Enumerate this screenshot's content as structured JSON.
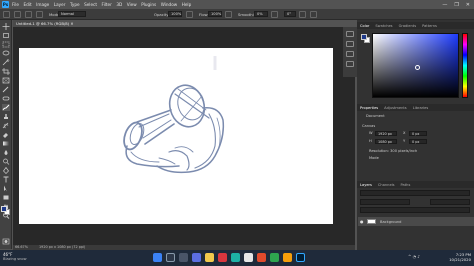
{
  "menu": {
    "items": [
      "File",
      "Edit",
      "Image",
      "Layer",
      "Type",
      "Select",
      "Filter",
      "3D",
      "View",
      "Plugins",
      "Window",
      "Help"
    ],
    "window_controls": [
      "—",
      "❐",
      "✕"
    ]
  },
  "options_bar": {
    "mode_label": "Mode:",
    "mode_value": "Normal",
    "opacity_label": "Opacity:",
    "opacity_value": "100%",
    "flow_label": "Flow:",
    "flow_value": "100%",
    "smoothing_label": "Smoothing:",
    "smoothing_value": "0%",
    "angle_value": "0°"
  },
  "document": {
    "tab_title": "Untitled-1 @ 66.7% (RGB/8) ✕"
  },
  "status_bar": {
    "zoom": "66.67%",
    "doc_size": "1920 px x 1080 px (72 ppi)"
  },
  "color_panel": {
    "tabs": [
      "Color",
      "Swatches",
      "Gradients",
      "Patterns"
    ],
    "active_tab": "Color",
    "foreground": "#1f3a8a",
    "background": "#ffffff"
  },
  "properties_panel": {
    "tabs": [
      "Properties",
      "Adjustments",
      "Libraries"
    ],
    "section": "Document",
    "canvas_heading": "Canvas",
    "width_value": "1920 px",
    "height_value": "1080 px",
    "x_value": "0 px",
    "y_value": "0 px",
    "resolution": "Resolution: 300 pixels/inch",
    "mode": "Mode"
  },
  "layers_panel": {
    "tabs": [
      "Layers",
      "Channels",
      "Paths"
    ],
    "layer_name": "Background"
  },
  "taskbar": {
    "temperature": "46°F",
    "weather": "Blazing snow",
    "time": "7:23 PM",
    "date": "10/21/2020"
  }
}
